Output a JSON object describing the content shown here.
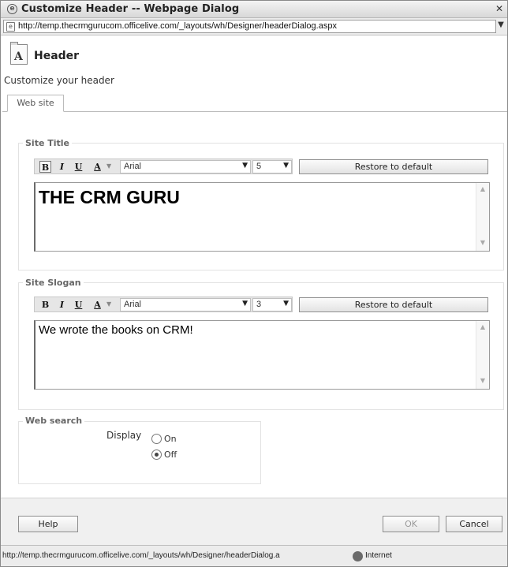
{
  "window": {
    "title": "Customize Header -- Webpage Dialog",
    "close_glyph": "✕",
    "url": "http://temp.thecrmgurucom.officelive.com/_layouts/wh/Designer/headerDialog.aspx"
  },
  "header": {
    "icon_glyph": "A",
    "title": "Header",
    "description": "Customize your header"
  },
  "tabs": [
    {
      "label": "Web site",
      "selected": true
    }
  ],
  "site_title": {
    "legend": "Site Title",
    "toolbar": {
      "bold": "B",
      "italic": "I",
      "underline": "U",
      "color": "A",
      "font": "Arial",
      "size": "5"
    },
    "restore_label": "Restore to default",
    "value": "THE CRM GURU"
  },
  "site_slogan": {
    "legend": "Site Slogan",
    "toolbar": {
      "bold": "B",
      "italic": "I",
      "underline": "U",
      "color": "A",
      "font": "Arial",
      "size": "3"
    },
    "restore_label": "Restore to default",
    "value": "We wrote the books on CRM!"
  },
  "web_search": {
    "legend": "Web search",
    "display_label": "Display",
    "options": [
      {
        "label": "On",
        "selected": false
      },
      {
        "label": "Off",
        "selected": true
      }
    ]
  },
  "footer": {
    "help_label": "Help",
    "ok_label": "OK",
    "cancel_label": "Cancel"
  },
  "statusbar": {
    "text": "http://temp.thecrmgurucom.officelive.com/_layouts/wh/Designer/headerDialog.a",
    "zone": "Internet"
  }
}
